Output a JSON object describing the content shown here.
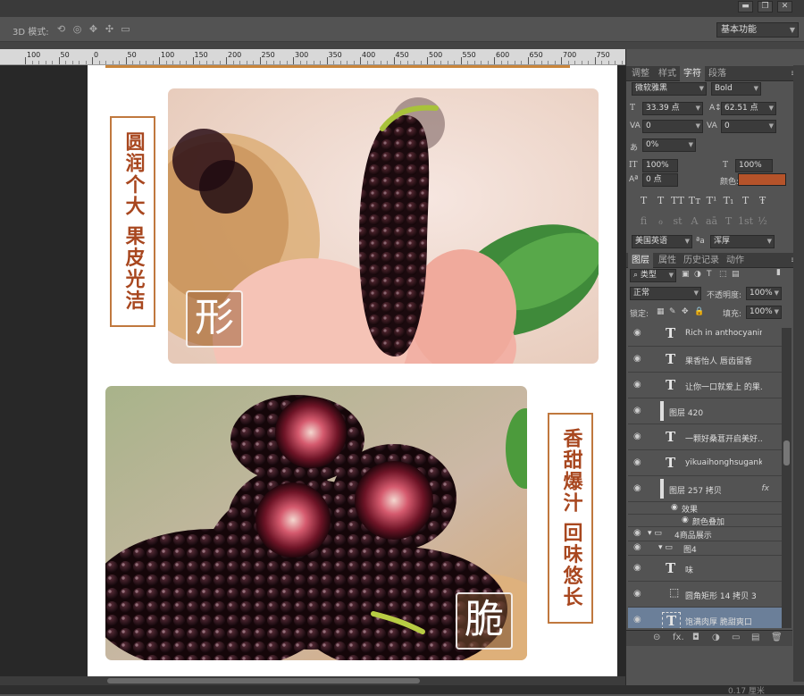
{
  "window": {
    "minimize": "▬",
    "restore": "❐",
    "close": "✕"
  },
  "options_bar": {
    "mode_label": "3D 模式:",
    "workspace": "基本功能"
  },
  "ruler": {
    "ticks": [
      "100",
      "50",
      "0",
      "50",
      "100",
      "150",
      "200",
      "250",
      "300",
      "350",
      "400",
      "450",
      "500",
      "550",
      "600",
      "650",
      "700",
      "750"
    ]
  },
  "artwork": {
    "label1": "圆润个大 果皮光洁",
    "label2": "香甜爆汁 回味悠长",
    "badge1": "形",
    "badge2": "脆"
  },
  "panel_tabs": {
    "items": [
      "调整",
      "样式",
      "字符",
      "段落"
    ],
    "active": 2
  },
  "character": {
    "font_family": "微软雅黑",
    "font_style": "Bold",
    "font_size": "33.39 点",
    "leading": "62.51 点",
    "kerning": "0",
    "tracking": "0",
    "scale_pct": "0%",
    "vscale": "100%",
    "hscale": "100%",
    "baseline": "0 点",
    "color_label": "颜色:",
    "color": "#b5532a",
    "style_glyphs": [
      "T",
      "T",
      "TT",
      "Tт",
      "T¹",
      "T₁",
      "T",
      "Ŧ"
    ],
    "ot_glyphs": [
      "fi",
      "ℴ",
      "st",
      "A",
      "aā",
      "T",
      "1st",
      "½"
    ],
    "language": "美国英语",
    "aa_label": "ªa",
    "antialias": "浑厚"
  },
  "layers_tabs": {
    "items": [
      "图层",
      "属性",
      "历史记录",
      "动作"
    ],
    "active": 0
  },
  "layers_controls": {
    "filter": "类型",
    "blend": "正常",
    "opacity_label": "不透明度:",
    "opacity": "100%",
    "lock_label": "锁定:",
    "fill_label": "填充:",
    "fill": "100%"
  },
  "layers": [
    {
      "kind": "text",
      "name": "Rich in anthocyanins Y..."
    },
    {
      "kind": "text",
      "name": "果香怡人 唇齿留香"
    },
    {
      "kind": "text",
      "name": "让你一口就爱上 的果..."
    },
    {
      "kind": "pixel",
      "name": "图层 420"
    },
    {
      "kind": "text",
      "name": "一颗好桑葚开启美好..."
    },
    {
      "kind": "text",
      "name": "yikuaihonghsugankaiqi..."
    },
    {
      "kind": "pixel",
      "name": "图层 257 拷贝",
      "fx": "fx"
    },
    {
      "kind": "effect",
      "name": "效果"
    },
    {
      "kind": "effect2",
      "name": "颜色叠加"
    },
    {
      "kind": "group",
      "name": "4商品展示"
    },
    {
      "kind": "group2",
      "name": "图4"
    },
    {
      "kind": "text",
      "name": "味"
    },
    {
      "kind": "shape",
      "name": "圆角矩形 14 拷贝 3"
    },
    {
      "kind": "textsel",
      "name": "饱满肉厚 脆甜爽口"
    }
  ],
  "layers_bottom": [
    "⊝",
    "fx.",
    "◘",
    "◑",
    "▭",
    "▤",
    "🗑"
  ],
  "status": {
    "text": "0.17 厘米"
  }
}
